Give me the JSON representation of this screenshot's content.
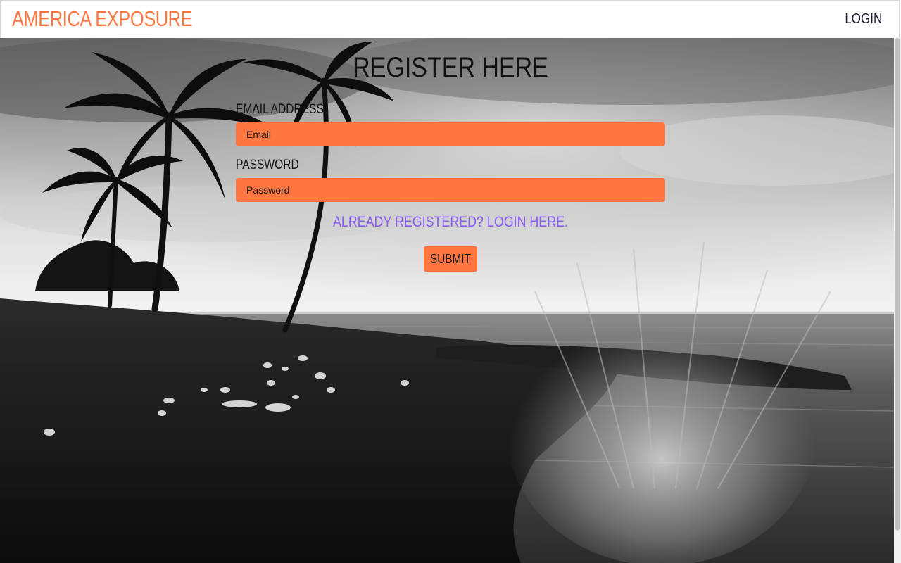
{
  "navbar": {
    "brand": "AMERICA EXPOSURE",
    "login": "LOGIN"
  },
  "form": {
    "title": "REGISTER HERE",
    "email_label": "EMAIL ADDRESS",
    "email_placeholder": "Email",
    "email_value": "",
    "password_label": "PASSWORD",
    "password_placeholder": "Password",
    "password_value": "",
    "login_link": "ALREADY REGISTERED? LOGIN HERE.",
    "submit": "SUBMIT"
  },
  "background": {
    "description_icon": "beach-palm-photo"
  },
  "colors": {
    "accent": "#ff7640",
    "link": "#8a5cf6",
    "text": "#111111"
  }
}
